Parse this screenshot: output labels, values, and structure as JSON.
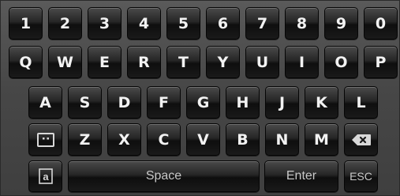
{
  "keyboard": {
    "row1": [
      "1",
      "2",
      "3",
      "4",
      "5",
      "6",
      "7",
      "8",
      "9",
      "0"
    ],
    "row2": [
      "Q",
      "W",
      "E",
      "R",
      "T",
      "Y",
      "U",
      "I",
      "O",
      "P"
    ],
    "row3": [
      "A",
      "S",
      "D",
      "F",
      "G",
      "H",
      "J",
      "K",
      "L"
    ],
    "row4": [
      "Z",
      "X",
      "C",
      "V",
      "B",
      "N",
      "M"
    ],
    "space_label": "Space",
    "enter_label": "Enter",
    "esc_label": "ESC",
    "icons": {
      "toggle": "input-mode-icon",
      "backspace": "backspace-icon",
      "case": "case-toggle-icon"
    }
  }
}
